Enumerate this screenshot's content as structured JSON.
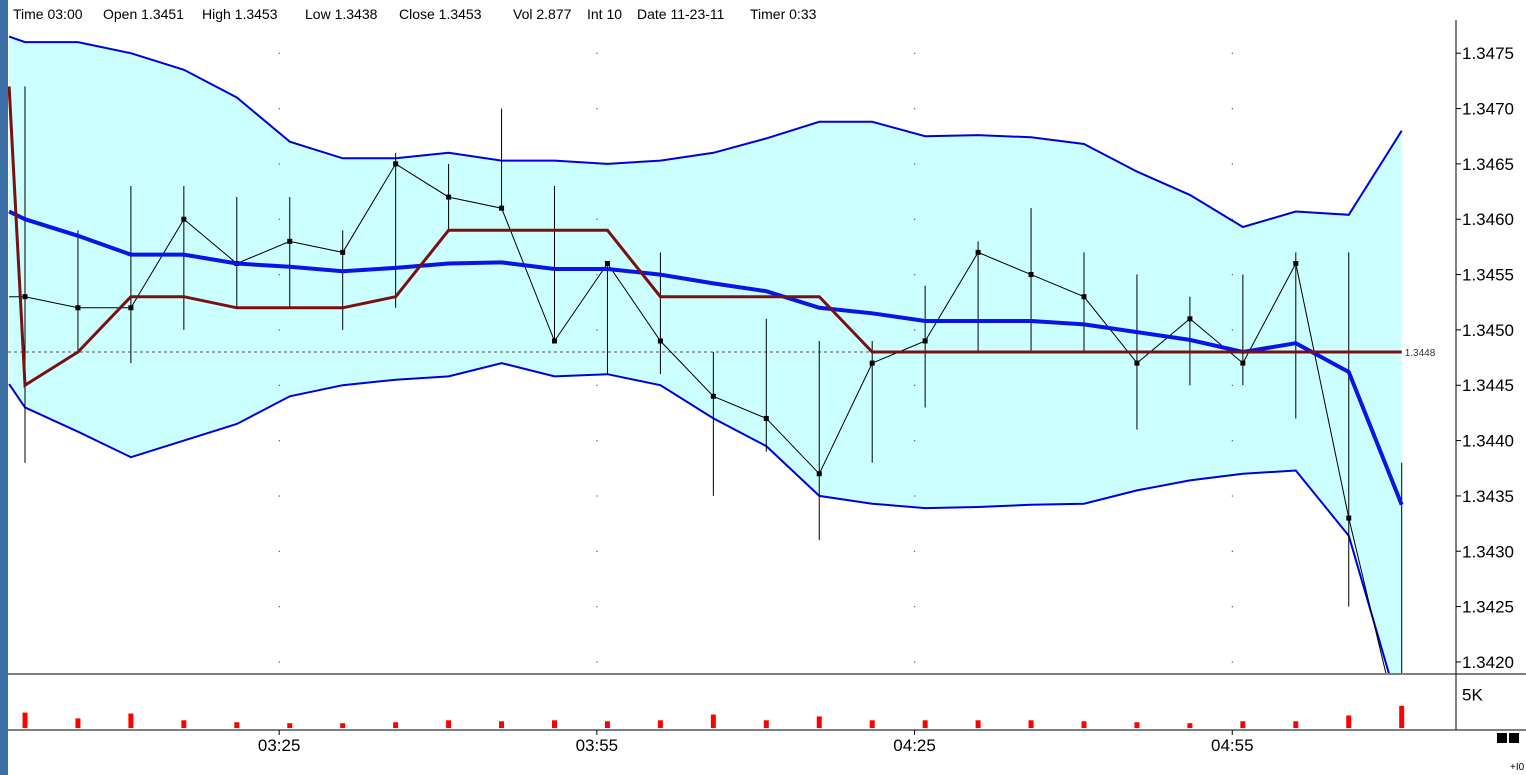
{
  "info_bar": {
    "time": "Time 03:00",
    "open": "Open 1.3451",
    "high": "High 1.3453",
    "low": "Low 1.3438",
    "close": "Close 1.3453",
    "vol": "Vol 2.877",
    "int": "Int 10",
    "date": "Date 11-23-11",
    "timer": "Timer 0:33"
  },
  "colors": {
    "band_fill": "#ccffff",
    "band_line": "#0000dd",
    "middle_line": "#0a14e6",
    "step_line": "#7a1010",
    "price": "#000000",
    "volume": "#ff0000",
    "last_price_line": "#7a1010"
  },
  "chart_data": {
    "type": "line",
    "title": "",
    "ylim": [
      1.3419,
      1.3478
    ],
    "y_ticks": [
      "1.3475",
      "1.3470",
      "1.3465",
      "1.3460",
      "1.3455",
      "1.3450",
      "1.3445",
      "1.3440",
      "1.3435",
      "1.3430",
      "1.3425",
      "1.3420"
    ],
    "x_ticks": [
      {
        "label": "03:25",
        "at": 4.8
      },
      {
        "label": "03:55",
        "at": 10.8
      },
      {
        "label": "04:25",
        "at": 16.8
      },
      {
        "label": "04:55",
        "at": 22.8
      }
    ],
    "x_index": [
      -0.3,
      0,
      1,
      2,
      3,
      4,
      5,
      6,
      7,
      8,
      9,
      10,
      11,
      12,
      13,
      14,
      15,
      16,
      17,
      18,
      19,
      20,
      21,
      22,
      23,
      24,
      25,
      26
    ],
    "bars": {
      "x": [
        0,
        1,
        2,
        3,
        4,
        5,
        6,
        7,
        8,
        9,
        10,
        11,
        12,
        13,
        14,
        15,
        16,
        17,
        18,
        19,
        20,
        21,
        22,
        23,
        24,
        25,
        26
      ],
      "high": [
        1.3472,
        1.3459,
        1.3463,
        1.3463,
        1.3462,
        1.3462,
        1.3459,
        1.3466,
        1.3465,
        1.347,
        1.3463,
        1.3456,
        1.3457,
        1.3448,
        1.3451,
        1.3449,
        1.3449,
        1.3454,
        1.3458,
        1.3461,
        1.3457,
        1.3455,
        1.3453,
        1.3455,
        1.3457,
        1.3457,
        1.3438
      ],
      "low": [
        1.3438,
        1.3448,
        1.3447,
        1.345,
        1.3452,
        1.3452,
        1.345,
        1.3452,
        1.3459,
        1.3461,
        1.3449,
        1.3446,
        1.3446,
        1.3435,
        1.3439,
        1.3431,
        1.3438,
        1.3443,
        1.3448,
        1.3448,
        1.3448,
        1.3441,
        1.3445,
        1.3445,
        1.3442,
        1.3425,
        1.3419
      ],
      "close": [
        1.3453,
        1.3452,
        1.3452,
        1.346,
        1.3456,
        1.3458,
        1.3457,
        1.3465,
        1.3462,
        1.3461,
        1.3449,
        1.3456,
        1.3449,
        1.3444,
        1.3442,
        1.3437,
        1.3447,
        1.3449,
        1.3457,
        1.3455,
        1.3453,
        1.3447,
        1.3451,
        1.3447,
        1.3456,
        1.3433,
        1.3413
      ]
    },
    "series": [
      {
        "x": [
          -0.3,
          0,
          1,
          2,
          3,
          4,
          5,
          6,
          7,
          8,
          9,
          10,
          11,
          12,
          13,
          14,
          15,
          16,
          17,
          18,
          19,
          20,
          21,
          22,
          23,
          24,
          25,
          26
        ],
        "values": [
          1.34485,
          1.34483,
          1.34475,
          1.34475,
          1.34475,
          1.34475,
          1.34475,
          1.34475,
          1.34475,
          1.34475,
          1.34475,
          1.34475,
          1.34475,
          1.34475,
          1.34475,
          1.34475,
          1.34475,
          1.34475,
          1.34475,
          1.34475,
          1.34475,
          1.34475,
          1.34475,
          1.34475,
          1.34475,
          1.34475,
          1.34475,
          1.34475
        ],
        "hidden": true
      },
      {
        "x": [
          -0.3,
          0,
          1,
          2,
          3,
          4,
          5,
          6,
          7,
          8,
          9,
          10,
          11,
          12,
          13,
          14,
          15,
          16,
          17,
          18,
          19,
          20,
          21,
          22,
          23,
          24,
          25,
          26
        ],
        "values": [
          1.34765,
          1.3476,
          1.3476,
          1.3475,
          1.34735,
          1.3471,
          1.3467,
          1.34655,
          1.34655,
          1.3466,
          1.34653,
          1.34653,
          1.3465,
          1.34653,
          1.3466,
          1.34673,
          1.34688,
          1.34688,
          1.34675,
          1.34676,
          1.34674,
          1.34668,
          1.34643,
          1.34622,
          1.34593,
          1.34607,
          1.34604,
          1.3468
        ]
      },
      {
        "x": [
          -0.3,
          0,
          1,
          2,
          3,
          4,
          5,
          6,
          7,
          8,
          9,
          10,
          11,
          12,
          13,
          14,
          15,
          16,
          17,
          18,
          19,
          20,
          21,
          22,
          23,
          24,
          25,
          26
        ],
        "values": [
          1.34451,
          1.3443,
          1.34408,
          1.34385,
          1.344,
          1.34415,
          1.3444,
          1.3445,
          1.34455,
          1.34458,
          1.3447,
          1.34458,
          1.3446,
          1.3445,
          1.3442,
          1.34395,
          1.3435,
          1.34343,
          1.34339,
          1.3434,
          1.34342,
          1.34343,
          1.34355,
          1.34364,
          1.3437,
          1.34373,
          1.34314,
          1.3415
        ]
      },
      {
        "x": [
          -0.3,
          0,
          1,
          2,
          3,
          4,
          5,
          6,
          7,
          8,
          9,
          10,
          11,
          12,
          13,
          14,
          15,
          16,
          17,
          18,
          19,
          20,
          21,
          22,
          23,
          24,
          25,
          26
        ],
        "values": [
          1.34607,
          1.346,
          1.34585,
          1.34568,
          1.34568,
          1.3456,
          1.34557,
          1.34553,
          1.34556,
          1.3456,
          1.34561,
          1.34555,
          1.34555,
          1.3455,
          1.34542,
          1.34535,
          1.3452,
          1.34515,
          1.34508,
          1.34508,
          1.34508,
          1.34505,
          1.34498,
          1.34491,
          1.3448,
          1.34488,
          1.34462,
          1.34342
        ]
      },
      {
        "x": [
          -0.3,
          0,
          1,
          2,
          3,
          4,
          5,
          6,
          7,
          8,
          9,
          10,
          11,
          12,
          13,
          14,
          15,
          16,
          17,
          18,
          19,
          20,
          21,
          22,
          23,
          24,
          25,
          26
        ],
        "values": [
          1.3472,
          1.3445,
          1.3448,
          1.3453,
          1.3453,
          1.3452,
          1.3452,
          1.3452,
          1.3453,
          1.3459,
          1.3459,
          1.3459,
          1.3459,
          1.3453,
          1.3453,
          1.3453,
          1.3453,
          1.3448,
          1.3448,
          1.3448,
          1.3448,
          1.3448,
          1.3448,
          1.3448,
          1.3448,
          1.3448,
          1.3448,
          1.3448
        ]
      }
    ],
    "last_price": {
      "value": 1.3448,
      "label": "1.3448"
    },
    "volume": {
      "x": [
        0,
        1,
        2,
        3,
        4,
        5,
        6,
        7,
        8,
        9,
        10,
        11,
        12,
        13,
        14,
        15,
        16,
        17,
        18,
        19,
        20,
        21,
        22,
        23,
        24,
        25,
        26
      ],
      "values": [
        1.6,
        1.0,
        1.5,
        0.8,
        0.6,
        0.5,
        0.5,
        0.6,
        0.8,
        0.7,
        0.8,
        0.7,
        0.8,
        1.4,
        0.8,
        1.2,
        0.8,
        0.8,
        0.8,
        0.8,
        0.7,
        0.6,
        0.5,
        0.7,
        0.7,
        1.3,
        2.3,
        5.5
      ],
      "axis_label": "5K",
      "axis_value": 3.5,
      "ylim": [
        0,
        5.5
      ]
    },
    "corner_label": "+I0",
    "grid": "dotted"
  }
}
